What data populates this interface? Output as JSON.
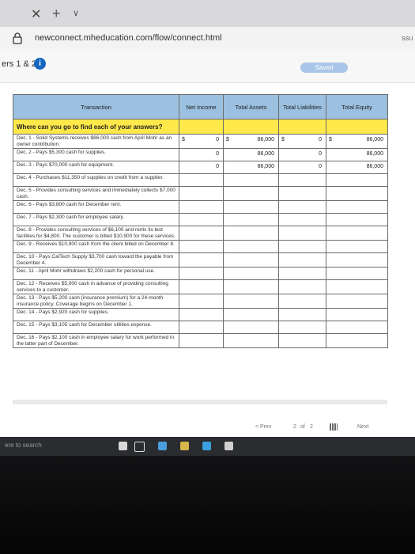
{
  "browser": {
    "url": "newconnect.mheducation.com/flow/connect.html",
    "tab_close": "✕",
    "tab_new": "+",
    "tab_menu": "∨"
  },
  "page": {
    "title": "ers 1 & 2",
    "info": "i",
    "saved": "Saved",
    "corner": "SSU"
  },
  "table": {
    "headers": [
      "Transaction",
      "Net Income",
      "Total Assets",
      "Total Liabilities",
      "Total Equity"
    ],
    "question": "Where can you go to find each of your answers?",
    "rows": [
      {
        "t": "Dec. 1 - Solid Systems receives $86,000 cash from April Mohr as an owner contribution.",
        "ni_sym": "$",
        "ni": "0",
        "ta_sym": "$",
        "ta": "86,000",
        "tl_sym": "$",
        "tl": "0",
        "te_sym": "$",
        "te": "86,000"
      },
      {
        "t": "Dec. 2 - Pays $5,300 cash for supplies.",
        "ni_sym": "",
        "ni": "0",
        "ta_sym": "",
        "ta": "86,000",
        "tl_sym": "",
        "tl": "0",
        "te_sym": "",
        "te": "86,000"
      },
      {
        "t": "Dec. 3 - Pays $70,000 cash for equipment.",
        "ni_sym": "",
        "ni": "0",
        "ta_sym": "",
        "ta": "86,000",
        "tl_sym": "",
        "tl": "0",
        "te_sym": "",
        "te": "86,000"
      },
      {
        "t": "Dec. 4 - Purchases $11,350 of supplies on credit from a supplier.",
        "ni_sym": "",
        "ni": "",
        "ta_sym": "",
        "ta": "",
        "tl_sym": "",
        "tl": "",
        "te_sym": "",
        "te": ""
      },
      {
        "t": "Dec. 5 - Provides consulting services and immediately collects $7,000 cash.",
        "ni_sym": "",
        "ni": "",
        "ta_sym": "",
        "ta": "",
        "tl_sym": "",
        "tl": "",
        "te_sym": "",
        "te": ""
      },
      {
        "t": "Dec. 6 - Pays $3,800 cash for December rent.",
        "ni_sym": "",
        "ni": "",
        "ta_sym": "",
        "ta": "",
        "tl_sym": "",
        "tl": "",
        "te_sym": "",
        "te": ""
      },
      {
        "t": "Dec. 7 - Pays $2,300 cash for employee salary.",
        "ni_sym": "",
        "ni": "",
        "ta_sym": "",
        "ta": "",
        "tl_sym": "",
        "tl": "",
        "te_sym": "",
        "te": ""
      },
      {
        "t": "Dec. 8 - Provides consulting services of $6,100 and rents its test facilities for $4,800. The customer is billed $10,900 for these services.",
        "ni_sym": "",
        "ni": "",
        "ta_sym": "",
        "ta": "",
        "tl_sym": "",
        "tl": "",
        "te_sym": "",
        "te": ""
      },
      {
        "t": "Dec. 9 - Receives $10,900 cash from the client billed on December 8.",
        "ni_sym": "",
        "ni": "",
        "ta_sym": "",
        "ta": "",
        "tl_sym": "",
        "tl": "",
        "te_sym": "",
        "te": ""
      },
      {
        "t": "Dec. 10 - Pays CalTech Supply $3,700 cash toward the payable from December 4.",
        "ni_sym": "",
        "ni": "",
        "ta_sym": "",
        "ta": "",
        "tl_sym": "",
        "tl": "",
        "te_sym": "",
        "te": ""
      },
      {
        "t": "Dec. 11 - April Mohr withdraws $2,200 cash for personal use.",
        "ni_sym": "",
        "ni": "",
        "ta_sym": "",
        "ta": "",
        "tl_sym": "",
        "tl": "",
        "te_sym": "",
        "te": ""
      },
      {
        "t": "Dec. 12 - Receives $5,000 cash in advance of providing consulting services to a customer.",
        "ni_sym": "",
        "ni": "",
        "ta_sym": "",
        "ta": "",
        "tl_sym": "",
        "tl": "",
        "te_sym": "",
        "te": ""
      },
      {
        "t": "Dec. 13 - Pays $5,200 cash (insurance premium) for a 24-month insurance policy. Coverage begins on December 1.",
        "ni_sym": "",
        "ni": "",
        "ta_sym": "",
        "ta": "",
        "tl_sym": "",
        "tl": "",
        "te_sym": "",
        "te": ""
      },
      {
        "t": "Dec. 14 - Pays $2,920 cash for supplies.",
        "ni_sym": "",
        "ni": "",
        "ta_sym": "",
        "ta": "",
        "tl_sym": "",
        "tl": "",
        "te_sym": "",
        "te": ""
      },
      {
        "t": "Dec. 15 - Pays $3,105 cash for December utilities expense.",
        "ni_sym": "",
        "ni": "",
        "ta_sym": "",
        "ta": "",
        "tl_sym": "",
        "tl": "",
        "te_sym": "",
        "te": ""
      },
      {
        "t": "Dec. 16 - Pays $2,100 cash in employee salary for work performed in the latter part of December.",
        "ni_sym": "",
        "ni": "",
        "ta_sym": "",
        "ta": "",
        "tl_sym": "",
        "tl": "",
        "te_sym": "",
        "te": ""
      }
    ]
  },
  "pager": {
    "prev": "< Prev",
    "current": "2",
    "of": "of",
    "total": "2",
    "next": "Next"
  },
  "taskbar": {
    "search": "ere to search"
  }
}
